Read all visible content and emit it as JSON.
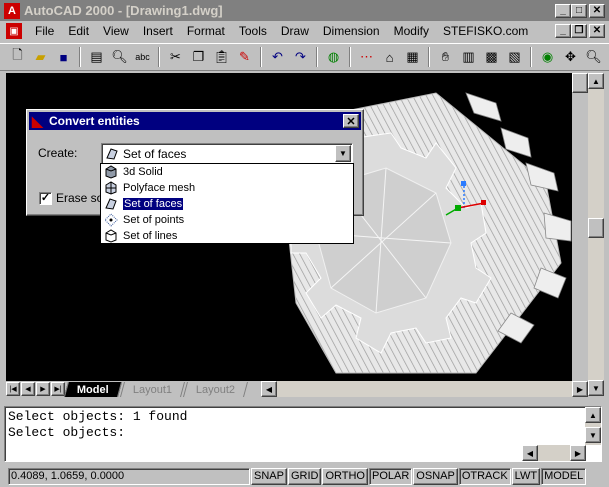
{
  "window": {
    "title": "AutoCAD 2000 - [Drawing1.dwg]",
    "minimize_glyph": "_",
    "maximize_glyph": "□",
    "close_glyph": "✕"
  },
  "menubar": {
    "items": [
      "File",
      "Edit",
      "View",
      "Insert",
      "Format",
      "Tools",
      "Draw",
      "Dimension",
      "Modify",
      "STEFISKO.com"
    ]
  },
  "toolbar": {
    "icons": [
      "new-icon",
      "open-icon",
      "save-icon",
      "print-icon",
      "preview-icon",
      "spell-icon",
      "cut-icon",
      "copy-icon",
      "paste-icon",
      "match-properties-icon",
      "undo-icon",
      "redo-icon",
      "web-icon",
      "snap-from-icon",
      "ucs-icon",
      "properties-icon",
      "design-center-icon",
      "layer-icon",
      "zoom-icon"
    ]
  },
  "layout_tabs": {
    "tabs": [
      {
        "label": "Model",
        "active": true
      },
      {
        "label": "Layout1",
        "active": false
      },
      {
        "label": "Layout2",
        "active": false
      }
    ]
  },
  "command_line": {
    "lines": [
      "Select objects: 1 found",
      "Select objects:"
    ]
  },
  "status_bar": {
    "coords": "0.4089, 1.0659, 0.0000",
    "toggles": [
      "SNAP",
      "GRID",
      "ORTHO",
      "POLAR",
      "OSNAP",
      "OTRACK",
      "LWT",
      "MODEL"
    ]
  },
  "dialog": {
    "title": "Convert entities",
    "close_glyph": "✕",
    "create_label": "Create:",
    "create_value": "Set of faces",
    "erase_label": "Erase sou",
    "erase_checked": true,
    "options": [
      {
        "label": "3d Solid",
        "icon": "solid-box-icon",
        "selected": false
      },
      {
        "label": "Polyface mesh",
        "icon": "mesh-icon",
        "selected": false
      },
      {
        "label": "Set of faces",
        "icon": "faces-icon",
        "selected": true
      },
      {
        "label": "Set of points",
        "icon": "points-icon",
        "selected": false
      },
      {
        "label": "Set of lines",
        "icon": "lines-icon",
        "selected": false
      }
    ]
  },
  "colors": {
    "title_bar_bg": "#808080",
    "dialog_title_bg": "#000080",
    "drawing_bg": "#000000",
    "selection_bg": "#000080"
  }
}
